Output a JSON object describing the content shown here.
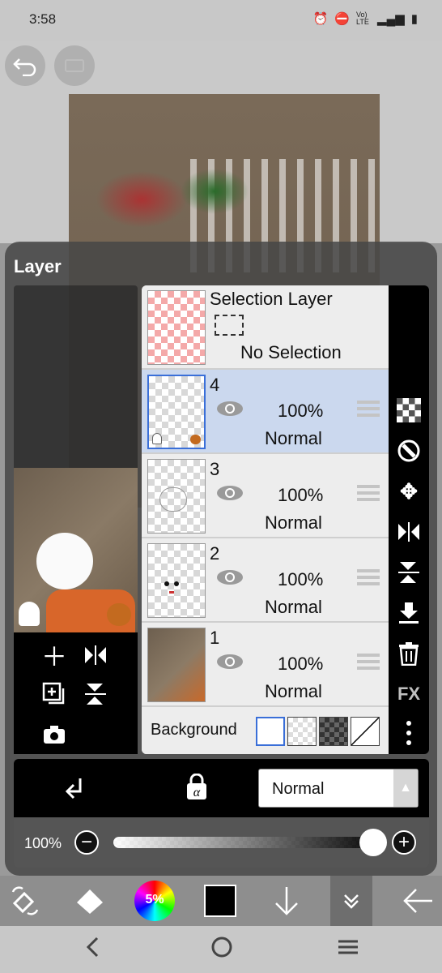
{
  "status_bar": {
    "time": "3:58",
    "icons": [
      "alarm-icon",
      "dnd-icon",
      "volte-icon",
      "signal-icon",
      "battery-icon"
    ],
    "volte_text": "Vo) LTE"
  },
  "canvas": {
    "undo_icon": "undo-icon",
    "redo_icon": "redo-icon"
  },
  "layer_panel": {
    "title": "Layer",
    "selection_layer": {
      "title": "Selection Layer",
      "status": "No Selection"
    },
    "layers": [
      {
        "number": "4",
        "opacity": "100%",
        "mode": "Normal",
        "selected": true
      },
      {
        "number": "3",
        "opacity": "100%",
        "mode": "Normal",
        "selected": false
      },
      {
        "number": "2",
        "opacity": "100%",
        "mode": "Normal",
        "selected": false
      },
      {
        "number": "1",
        "opacity": "100%",
        "mode": "Normal",
        "selected": false
      }
    ],
    "background": {
      "label": "Background",
      "options": [
        "white",
        "transparent",
        "dark-checker",
        "none"
      ]
    },
    "side_tools": [
      "checker-icon",
      "clip-icon",
      "move-icon",
      "flip-horizontal-icon",
      "flip-vertical-icon",
      "merge-down-icon",
      "trash-icon",
      "fx-icon",
      "more-icon"
    ],
    "fx_label": "FX",
    "preview_tools": [
      "add-layer-icon",
      "flip-horizontal-icon",
      "duplicate-layer-icon",
      "flip-vertical-icon",
      "camera-icon"
    ]
  },
  "blend": {
    "clipping_icon": "clipping-arrow-icon",
    "alpha_lock_icon": "alpha-lock-icon",
    "mode_value": "Normal"
  },
  "opacity": {
    "label": "100%",
    "value": 1.0,
    "minus": "−",
    "plus": "+"
  },
  "toolbar": {
    "color_wheel_label": "5%",
    "primary_color": "#000000",
    "items": [
      "transform-tool-icon",
      "fill-tool-icon",
      "color-wheel",
      "color-chip",
      "down-arrow-icon",
      "collapse-icon",
      "back-arrow-icon"
    ]
  },
  "navigation": [
    "back-nav",
    "home-nav",
    "recents-nav"
  ]
}
